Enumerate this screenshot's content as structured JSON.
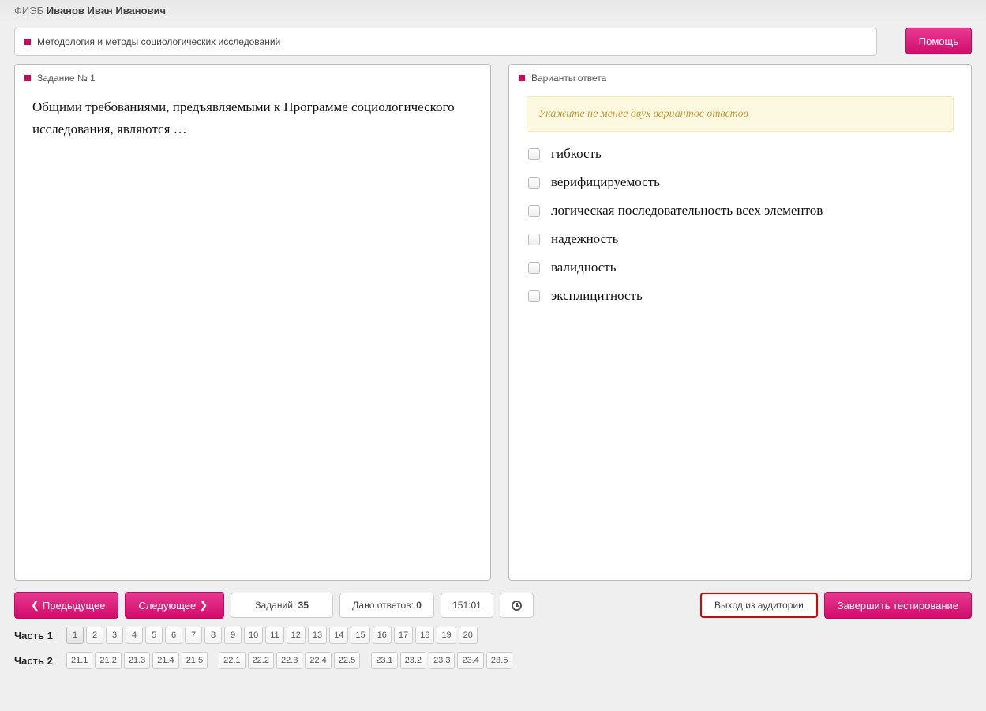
{
  "header": {
    "prefix": "ФИЭБ",
    "name": "Иванов Иван Иванович"
  },
  "topic": "Методология и методы социологических исследований",
  "help_label": "Помощь",
  "question_panel": {
    "title": "Задание № 1",
    "text": "Общими требованиями, предъявляемыми к Программе социологического исследования, являются …"
  },
  "answers_panel": {
    "title": "Варианты ответа",
    "hint": "Укажите не менее двух вариантов ответов",
    "options": [
      "гибкость",
      "верифицируемость",
      "логическая последовательность всех элементов",
      "надежность",
      "валидность",
      "эксплицитность"
    ]
  },
  "footer": {
    "prev": "Предыдущее",
    "next": "Следующее",
    "tasks_label": "Заданий:",
    "tasks_count": "35",
    "answered_label": "Дано ответов:",
    "answered_count": "0",
    "timer": "151:01",
    "exit": "Выход из аудитории",
    "finish": "Завершить тестирование"
  },
  "parts": {
    "part1_label": "Часть 1",
    "part1": [
      "1",
      "2",
      "3",
      "4",
      "5",
      "6",
      "7",
      "8",
      "9",
      "10",
      "11",
      "12",
      "13",
      "14",
      "15",
      "16",
      "17",
      "18",
      "19",
      "20"
    ],
    "part2_label": "Часть 2",
    "part2_groups": [
      [
        "21.1",
        "21.2",
        "21.3",
        "21.4",
        "21.5"
      ],
      [
        "22.1",
        "22.2",
        "22.3",
        "22.4",
        "22.5"
      ],
      [
        "23.1",
        "23.2",
        "23.3",
        "23.4",
        "23.5"
      ]
    ]
  }
}
